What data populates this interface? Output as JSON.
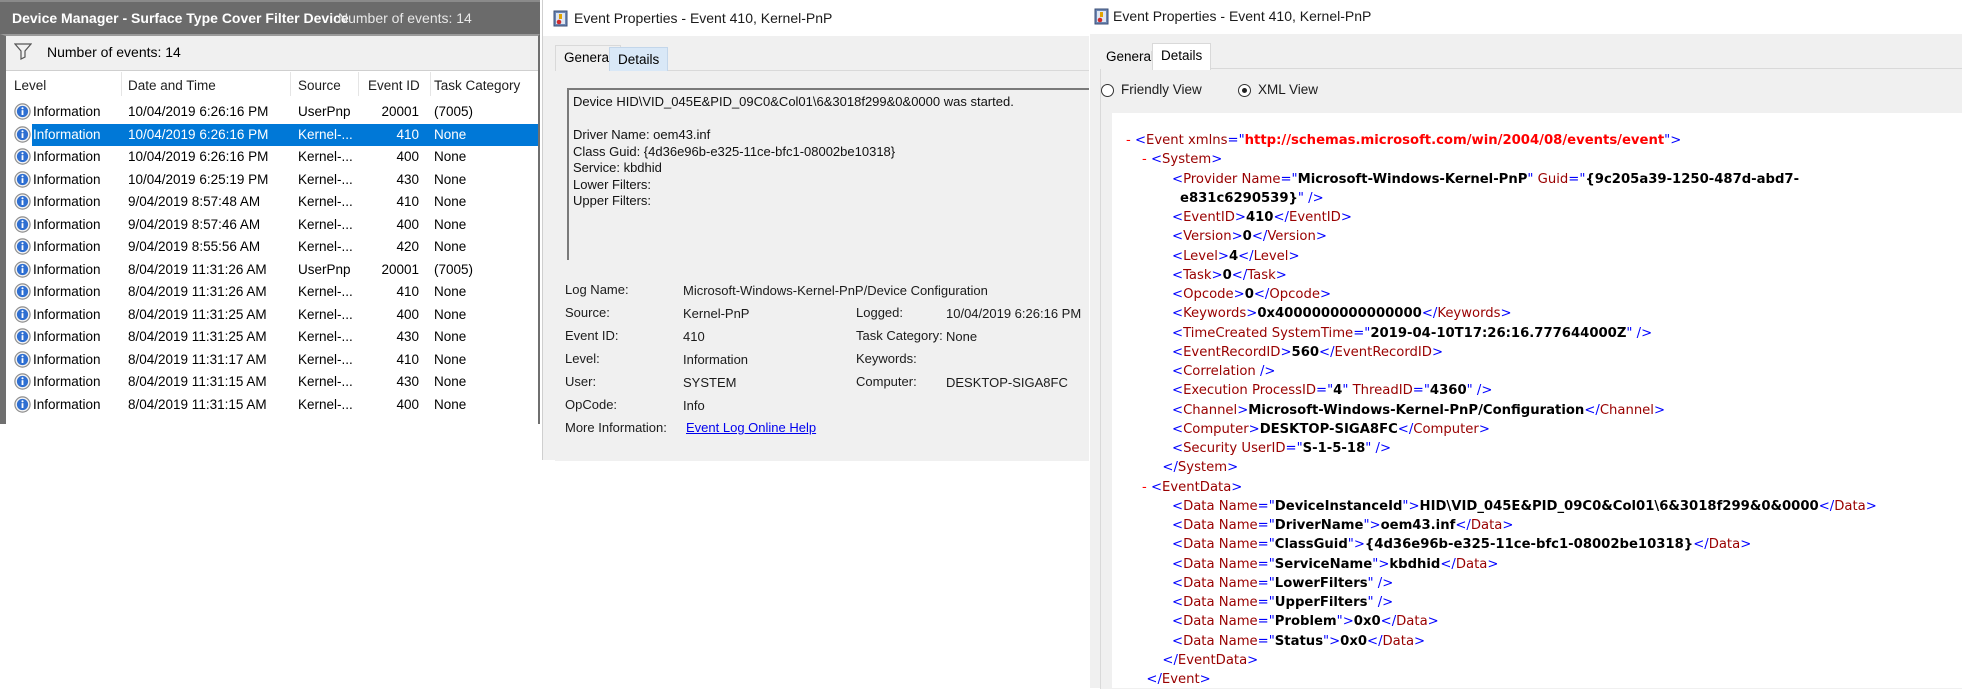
{
  "event_list": {
    "header_title": "Device Manager - Surface Type Cover Filter Device",
    "header_count": "Number of events: 14",
    "filter_text": "Number of events: 14",
    "columns": [
      "Level",
      "Date and Time",
      "Source",
      "Event ID",
      "Task Category"
    ],
    "selected_index": 1,
    "rows": [
      {
        "level": "Information",
        "datetime": "10/04/2019 6:26:16 PM",
        "source": "UserPnp",
        "event_id": "20001",
        "task": "(7005)"
      },
      {
        "level": "Information",
        "datetime": "10/04/2019 6:26:16 PM",
        "source": "Kernel-...",
        "event_id": "410",
        "task": "None"
      },
      {
        "level": "Information",
        "datetime": "10/04/2019 6:26:16 PM",
        "source": "Kernel-...",
        "event_id": "400",
        "task": "None"
      },
      {
        "level": "Information",
        "datetime": "10/04/2019 6:25:19 PM",
        "source": "Kernel-...",
        "event_id": "430",
        "task": "None"
      },
      {
        "level": "Information",
        "datetime": "9/04/2019 8:57:48 AM",
        "source": "Kernel-...",
        "event_id": "410",
        "task": "None"
      },
      {
        "level": "Information",
        "datetime": "9/04/2019 8:57:46 AM",
        "source": "Kernel-...",
        "event_id": "400",
        "task": "None"
      },
      {
        "level": "Information",
        "datetime": "9/04/2019 8:55:56 AM",
        "source": "Kernel-...",
        "event_id": "420",
        "task": "None"
      },
      {
        "level": "Information",
        "datetime": "8/04/2019 11:31:26 AM",
        "source": "UserPnp",
        "event_id": "20001",
        "task": "(7005)"
      },
      {
        "level": "Information",
        "datetime": "8/04/2019 11:31:26 AM",
        "source": "Kernel-...",
        "event_id": "410",
        "task": "None"
      },
      {
        "level": "Information",
        "datetime": "8/04/2019 11:31:25 AM",
        "source": "Kernel-...",
        "event_id": "400",
        "task": "None"
      },
      {
        "level": "Information",
        "datetime": "8/04/2019 11:31:25 AM",
        "source": "Kernel-...",
        "event_id": "430",
        "task": "None"
      },
      {
        "level": "Information",
        "datetime": "8/04/2019 11:31:17 AM",
        "source": "Kernel-...",
        "event_id": "410",
        "task": "None"
      },
      {
        "level": "Information",
        "datetime": "8/04/2019 11:31:15 AM",
        "source": "Kernel-...",
        "event_id": "430",
        "task": "None"
      },
      {
        "level": "Information",
        "datetime": "8/04/2019 11:31:15 AM",
        "source": "Kernel-...",
        "event_id": "400",
        "task": "None"
      }
    ]
  },
  "general_window": {
    "title": "Event Properties - Event 410, Kernel-PnP",
    "tabs": [
      "General",
      "Details"
    ],
    "active_tab": "General",
    "message": "Device HID\\VID_045E&PID_09C0&Col01\\6&3018f299&0&0000 was started.\n\nDriver Name: oem43.inf\nClass Guid: {4d36e96b-e325-11ce-bfc1-08002be10318}\nService: kbdhid\nLower Filters:\nUpper Filters:",
    "fields": {
      "log_name_label": "Log Name:",
      "log_name": "Microsoft-Windows-Kernel-PnP/Device Configuration",
      "source_label": "Source:",
      "source": "Kernel-PnP",
      "logged_label": "Logged:",
      "logged": "10/04/2019 6:26:16 PM",
      "event_id_label": "Event ID:",
      "event_id": "410",
      "task_category_label": "Task Category:",
      "task_category": "None",
      "level_label": "Level:",
      "level": "Information",
      "keywords_label": "Keywords:",
      "keywords": "",
      "user_label": "User:",
      "user": "SYSTEM",
      "computer_label": "Computer:",
      "computer": "DESKTOP-SIGA8FC",
      "opcode_label": "OpCode:",
      "opcode": "Info",
      "more_info_label": "More Information:",
      "more_info_link": "Event Log Online Help"
    }
  },
  "details_window": {
    "title": "Event Properties - Event 410, Kernel-PnP",
    "tabs": [
      "General",
      "Details"
    ],
    "active_tab": "Details",
    "radio_friendly": "Friendly View",
    "radio_xml": "XML View",
    "selected_view": "XML View",
    "xml_lines": [
      {
        "indent": 0,
        "minus": true,
        "parts": [
          [
            "br",
            "<"
          ],
          [
            "tag",
            "Event"
          ],
          [
            "attr",
            " xmlns"
          ],
          [
            "br",
            "=\""
          ],
          [
            "ns",
            "http://schemas.microsoft.com/win/2004/08/events/event"
          ],
          [
            "br",
            "\">"
          ]
        ]
      },
      {
        "indent": 1,
        "minus": true,
        "parts": [
          [
            "br",
            "<"
          ],
          [
            "tag",
            "System"
          ],
          [
            "br",
            ">"
          ]
        ]
      },
      {
        "indent": 2,
        "parts": [
          [
            "br",
            "<"
          ],
          [
            "tag",
            "Provider"
          ],
          [
            "attr",
            " Name"
          ],
          [
            "br",
            "=\""
          ],
          [
            "val",
            "Microsoft-Windows-Kernel-PnP"
          ],
          [
            "br",
            "\""
          ],
          [
            "attr",
            " Guid"
          ],
          [
            "br",
            "=\""
          ],
          [
            "val",
            "{9c205a39-1250-487d-abd7-"
          ]
        ]
      },
      {
        "indent": 2.5,
        "parts": [
          [
            "val",
            "e831c6290539}"
          ],
          [
            "br",
            "\" />"
          ]
        ]
      },
      {
        "indent": 2,
        "parts": [
          [
            "br",
            "<"
          ],
          [
            "tag",
            "EventID"
          ],
          [
            "br",
            ">"
          ],
          [
            "val",
            "410"
          ],
          [
            "br",
            "</"
          ],
          [
            "tag",
            "EventID"
          ],
          [
            "br",
            ">"
          ]
        ]
      },
      {
        "indent": 2,
        "parts": [
          [
            "br",
            "<"
          ],
          [
            "tag",
            "Version"
          ],
          [
            "br",
            ">"
          ],
          [
            "val",
            "0"
          ],
          [
            "br",
            "</"
          ],
          [
            "tag",
            "Version"
          ],
          [
            "br",
            ">"
          ]
        ]
      },
      {
        "indent": 2,
        "parts": [
          [
            "br",
            "<"
          ],
          [
            "tag",
            "Level"
          ],
          [
            "br",
            ">"
          ],
          [
            "val",
            "4"
          ],
          [
            "br",
            "</"
          ],
          [
            "tag",
            "Level"
          ],
          [
            "br",
            ">"
          ]
        ]
      },
      {
        "indent": 2,
        "parts": [
          [
            "br",
            "<"
          ],
          [
            "tag",
            "Task"
          ],
          [
            "br",
            ">"
          ],
          [
            "val",
            "0"
          ],
          [
            "br",
            "</"
          ],
          [
            "tag",
            "Task"
          ],
          [
            "br",
            ">"
          ]
        ]
      },
      {
        "indent": 2,
        "parts": [
          [
            "br",
            "<"
          ],
          [
            "tag",
            "Opcode"
          ],
          [
            "br",
            ">"
          ],
          [
            "val",
            "0"
          ],
          [
            "br",
            "</"
          ],
          [
            "tag",
            "Opcode"
          ],
          [
            "br",
            ">"
          ]
        ]
      },
      {
        "indent": 2,
        "parts": [
          [
            "br",
            "<"
          ],
          [
            "tag",
            "Keywords"
          ],
          [
            "br",
            ">"
          ],
          [
            "val",
            "0x4000000000000000"
          ],
          [
            "br",
            "</"
          ],
          [
            "tag",
            "Keywords"
          ],
          [
            "br",
            ">"
          ]
        ]
      },
      {
        "indent": 2,
        "parts": [
          [
            "br",
            "<"
          ],
          [
            "tag",
            "TimeCreated"
          ],
          [
            "attr",
            " SystemTime"
          ],
          [
            "br",
            "=\""
          ],
          [
            "val",
            "2019-04-10T17:26:16.777644000Z"
          ],
          [
            "br",
            "\" />"
          ]
        ]
      },
      {
        "indent": 2,
        "parts": [
          [
            "br",
            "<"
          ],
          [
            "tag",
            "EventRecordID"
          ],
          [
            "br",
            ">"
          ],
          [
            "val",
            "560"
          ],
          [
            "br",
            "</"
          ],
          [
            "tag",
            "EventRecordID"
          ],
          [
            "br",
            ">"
          ]
        ]
      },
      {
        "indent": 2,
        "parts": [
          [
            "br",
            "<"
          ],
          [
            "tag",
            "Correlation"
          ],
          [
            "br",
            " />"
          ]
        ]
      },
      {
        "indent": 2,
        "parts": [
          [
            "br",
            "<"
          ],
          [
            "tag",
            "Execution"
          ],
          [
            "attr",
            " ProcessID"
          ],
          [
            "br",
            "=\""
          ],
          [
            "val",
            "4"
          ],
          [
            "br",
            "\""
          ],
          [
            "attr",
            " ThreadID"
          ],
          [
            "br",
            "=\""
          ],
          [
            "val",
            "4360"
          ],
          [
            "br",
            "\" />"
          ]
        ]
      },
      {
        "indent": 2,
        "parts": [
          [
            "br",
            "<"
          ],
          [
            "tag",
            "Channel"
          ],
          [
            "br",
            ">"
          ],
          [
            "val",
            "Microsoft-Windows-Kernel-PnP/Configuration"
          ],
          [
            "br",
            "</"
          ],
          [
            "tag",
            "Channel"
          ],
          [
            "br",
            ">"
          ]
        ]
      },
      {
        "indent": 2,
        "parts": [
          [
            "br",
            "<"
          ],
          [
            "tag",
            "Computer"
          ],
          [
            "br",
            ">"
          ],
          [
            "val",
            "DESKTOP-SIGA8FC"
          ],
          [
            "br",
            "</"
          ],
          [
            "tag",
            "Computer"
          ],
          [
            "br",
            ">"
          ]
        ]
      },
      {
        "indent": 2,
        "parts": [
          [
            "br",
            "<"
          ],
          [
            "tag",
            "Security"
          ],
          [
            "attr",
            " UserID"
          ],
          [
            "br",
            "=\""
          ],
          [
            "val",
            "S-1-5-18"
          ],
          [
            "br",
            "\" />"
          ]
        ]
      },
      {
        "indent": 1.4,
        "parts": [
          [
            "br",
            "</"
          ],
          [
            "tag",
            "System"
          ],
          [
            "br",
            ">"
          ]
        ]
      },
      {
        "indent": 1,
        "minus": true,
        "parts": [
          [
            "br",
            "<"
          ],
          [
            "tag",
            "EventData"
          ],
          [
            "br",
            ">"
          ]
        ]
      },
      {
        "indent": 2,
        "parts": [
          [
            "br",
            "<"
          ],
          [
            "tag",
            "Data"
          ],
          [
            "attr",
            " Name"
          ],
          [
            "br",
            "=\""
          ],
          [
            "val",
            "DeviceInstanceId"
          ],
          [
            "br",
            "\">"
          ],
          [
            "val",
            "HID\\VID_045E&PID_09C0&Col01\\6&3018f299&0&0000"
          ],
          [
            "br",
            "</"
          ],
          [
            "tag",
            "Data"
          ],
          [
            "br",
            ">"
          ]
        ]
      },
      {
        "indent": 2,
        "parts": [
          [
            "br",
            "<"
          ],
          [
            "tag",
            "Data"
          ],
          [
            "attr",
            " Name"
          ],
          [
            "br",
            "=\""
          ],
          [
            "val",
            "DriverName"
          ],
          [
            "br",
            "\">"
          ],
          [
            "val",
            "oem43.inf"
          ],
          [
            "br",
            "</"
          ],
          [
            "tag",
            "Data"
          ],
          [
            "br",
            ">"
          ]
        ]
      },
      {
        "indent": 2,
        "parts": [
          [
            "br",
            "<"
          ],
          [
            "tag",
            "Data"
          ],
          [
            "attr",
            " Name"
          ],
          [
            "br",
            "=\""
          ],
          [
            "val",
            "ClassGuid"
          ],
          [
            "br",
            "\">"
          ],
          [
            "val",
            "{4d36e96b-e325-11ce-bfc1-08002be10318}"
          ],
          [
            "br",
            "</"
          ],
          [
            "tag",
            "Data"
          ],
          [
            "br",
            ">"
          ]
        ]
      },
      {
        "indent": 2,
        "parts": [
          [
            "br",
            "<"
          ],
          [
            "tag",
            "Data"
          ],
          [
            "attr",
            " Name"
          ],
          [
            "br",
            "=\""
          ],
          [
            "val",
            "ServiceName"
          ],
          [
            "br",
            "\">"
          ],
          [
            "val",
            "kbdhid"
          ],
          [
            "br",
            "</"
          ],
          [
            "tag",
            "Data"
          ],
          [
            "br",
            ">"
          ]
        ]
      },
      {
        "indent": 2,
        "parts": [
          [
            "br",
            "<"
          ],
          [
            "tag",
            "Data"
          ],
          [
            "attr",
            " Name"
          ],
          [
            "br",
            "=\""
          ],
          [
            "val",
            "LowerFilters"
          ],
          [
            "br",
            "\" />"
          ]
        ]
      },
      {
        "indent": 2,
        "parts": [
          [
            "br",
            "<"
          ],
          [
            "tag",
            "Data"
          ],
          [
            "attr",
            " Name"
          ],
          [
            "br",
            "=\""
          ],
          [
            "val",
            "UpperFilters"
          ],
          [
            "br",
            "\" />"
          ]
        ]
      },
      {
        "indent": 2,
        "parts": [
          [
            "br",
            "<"
          ],
          [
            "tag",
            "Data"
          ],
          [
            "attr",
            " Name"
          ],
          [
            "br",
            "=\""
          ],
          [
            "val",
            "Problem"
          ],
          [
            "br",
            "\">"
          ],
          [
            "val",
            "0x0"
          ],
          [
            "br",
            "</"
          ],
          [
            "tag",
            "Data"
          ],
          [
            "br",
            ">"
          ]
        ]
      },
      {
        "indent": 2,
        "parts": [
          [
            "br",
            "<"
          ],
          [
            "tag",
            "Data"
          ],
          [
            "attr",
            " Name"
          ],
          [
            "br",
            "=\""
          ],
          [
            "val",
            "Status"
          ],
          [
            "br",
            "\">"
          ],
          [
            "val",
            "0x0"
          ],
          [
            "br",
            "</"
          ],
          [
            "tag",
            "Data"
          ],
          [
            "br",
            ">"
          ]
        ]
      },
      {
        "indent": 1.4,
        "parts": [
          [
            "br",
            "</"
          ],
          [
            "tag",
            "EventData"
          ],
          [
            "br",
            ">"
          ]
        ]
      },
      {
        "indent": 0.4,
        "parts": [
          [
            "br",
            "</"
          ],
          [
            "tag",
            "Event"
          ],
          [
            "br",
            ">"
          ]
        ]
      }
    ]
  },
  "colors": {
    "selection": "#0078d7",
    "header_bar": "#6b6b6b",
    "link": "#0000ee",
    "xml_bracket": "#0000ff",
    "xml_tag": "#990000",
    "xml_namespace": "#ff0000"
  }
}
